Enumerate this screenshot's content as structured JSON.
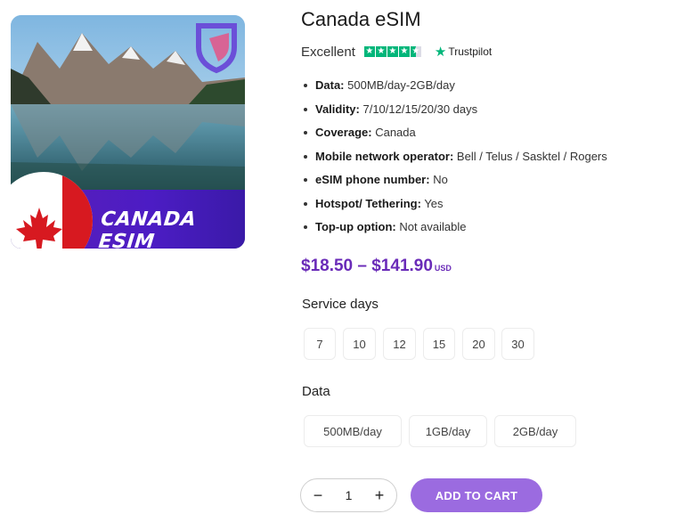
{
  "product": {
    "title": "Canada eSIM",
    "image_banner": "CANADA ESIM",
    "rating_label": "Excellent",
    "rating_stars": 4.5,
    "trustpilot_label": "Trustpilot",
    "features": [
      {
        "label": "Data:",
        "value": "500MB/day-2GB/day"
      },
      {
        "label": "Validity:",
        "value": "7/10/12/15/20/30 days"
      },
      {
        "label": "Coverage:",
        "value": "Canada"
      },
      {
        "label": "Mobile network operator:",
        "value": "Bell / Telus / Sasktel / Rogers"
      },
      {
        "label": "eSIM phone number:",
        "value": "No"
      },
      {
        "label": "Hotspot/ Tethering:",
        "value": "Yes"
      },
      {
        "label": "Top-up option:",
        "value": "Not available"
      }
    ],
    "price_range": "$18.50 – $141.90",
    "currency": "USD"
  },
  "options": {
    "service_days_label": "Service days",
    "service_days": [
      "7",
      "10",
      "12",
      "15",
      "20",
      "30"
    ],
    "data_label": "Data",
    "data_plans": [
      "500MB/day",
      "1GB/day",
      "2GB/day"
    ]
  },
  "cart": {
    "quantity": "1",
    "minus": "−",
    "plus": "+",
    "add_label": "ADD TO CART"
  },
  "colors": {
    "accent": "#6a2bb8",
    "button": "#9b6be0",
    "trustpilot": "#00b67a"
  }
}
